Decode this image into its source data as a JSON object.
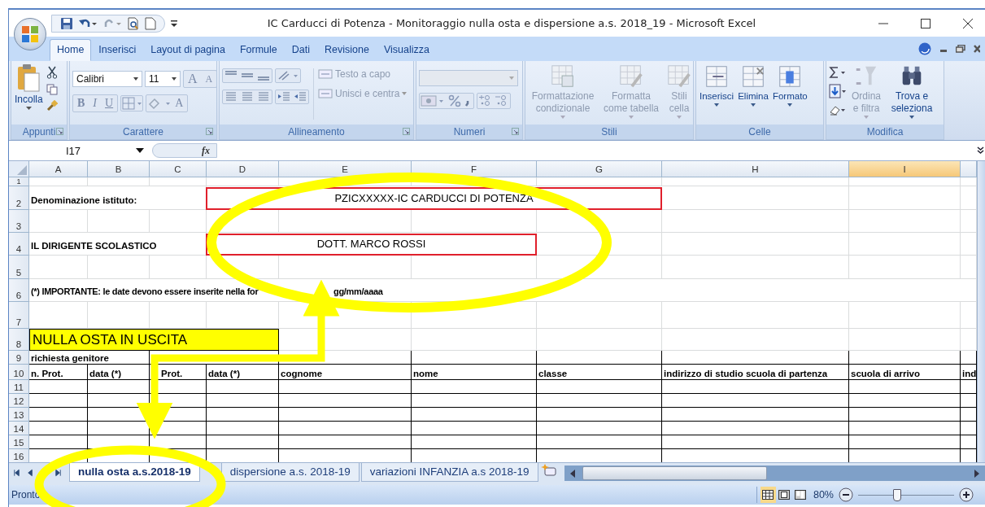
{
  "window": {
    "title": "IC Carducci di Potenza - Monitoraggio nulla osta e dispersione a.s. 2018_19 - Microsoft Excel"
  },
  "tabs": [
    {
      "label": "Home",
      "selected": true
    },
    {
      "label": "Inserisci",
      "selected": false
    },
    {
      "label": "Layout di pagina",
      "selected": false
    },
    {
      "label": "Formule",
      "selected": false
    },
    {
      "label": "Dati",
      "selected": false
    },
    {
      "label": "Revisione",
      "selected": false
    },
    {
      "label": "Visualizza",
      "selected": false
    }
  ],
  "ribbon": [
    {
      "kind": "clipboard",
      "label": "Appunti",
      "commands": [
        {
          "label": "Incolla",
          "disabled": false
        }
      ]
    },
    {
      "kind": "font",
      "label": "Carattere",
      "font": "Calibri",
      "size": "11",
      "buttons": [
        "B",
        "I",
        "U"
      ],
      "size_buttons": [
        "A",
        "A"
      ],
      "font_color": "A"
    },
    {
      "kind": "alignment",
      "label": "Allineamento",
      "commands": [
        {
          "label": "Testo a capo",
          "disabled": true
        },
        {
          "label": "Unisci e centra",
          "disabled": true
        }
      ]
    },
    {
      "kind": "number",
      "label": "Numeri"
    },
    {
      "kind": "styles",
      "label": "Stili",
      "commands": [
        {
          "label": "Formattazione condizionale",
          "disabled": true
        },
        {
          "label": "Formatta come tabella",
          "disabled": true
        },
        {
          "label": "Stili cella",
          "disabled": true
        }
      ]
    },
    {
      "kind": "cells",
      "label": "Celle",
      "commands": [
        {
          "label": "Inserisci",
          "disabled": false
        },
        {
          "label": "Elimina",
          "disabled": false
        },
        {
          "label": "Formato",
          "disabled": false
        }
      ]
    },
    {
      "kind": "editing",
      "label": "Modifica",
      "commands": [
        {
          "label": "Ordina e filtra",
          "disabled": true
        },
        {
          "label": "Trova e seleziona",
          "disabled": false
        }
      ]
    }
  ],
  "formula_bar": {
    "name_box": "I17",
    "function_symbol": "fx"
  },
  "columns": [
    {
      "label": "A",
      "selected": false
    },
    {
      "label": "B",
      "selected": false
    },
    {
      "label": "C",
      "selected": false
    },
    {
      "label": "D",
      "selected": false
    },
    {
      "label": "E",
      "selected": false
    },
    {
      "label": "F",
      "selected": false
    },
    {
      "label": "G",
      "selected": false
    },
    {
      "label": "H",
      "selected": false
    },
    {
      "label": "I",
      "selected": true
    }
  ],
  "rows": [
    {
      "number": "1",
      "kind": "plain"
    },
    {
      "number": "2",
      "kind": "plain",
      "cells": [
        {
          "kind": "label",
          "text": "Denominazione istituto:"
        },
        {
          "kind": "boxed",
          "text": "PZICXXXXX-IC CARDUCCI DI POTENZA"
        }
      ]
    },
    {
      "number": "3",
      "kind": "plain"
    },
    {
      "number": "4",
      "kind": "plain",
      "cells": [
        {
          "kind": "label",
          "text": "IL DIRIGENTE SCOLASTICO"
        },
        {
          "kind": "boxed",
          "text": "DOTT. MARCO ROSSI"
        }
      ]
    },
    {
      "number": "5",
      "kind": "plain"
    },
    {
      "number": "6",
      "kind": "plain",
      "cells": [
        {
          "kind": "note",
          "parts": [
            "(*) IMPORTANTE: le date devono essere inserite nella for",
            "gg/mm/aaaa"
          ]
        }
      ]
    },
    {
      "number": "7",
      "kind": "plain"
    },
    {
      "number": "8",
      "kind": "plain",
      "cells": [
        {
          "kind": "title",
          "text": "NULLA OSTA IN USCITA"
        }
      ]
    },
    {
      "number": "9",
      "kind": "table",
      "cells": [
        {
          "kind": "header",
          "text": "richiesta genitore"
        }
      ]
    },
    {
      "number": "10",
      "kind": "table",
      "cells": [
        {
          "kind": "header",
          "text": "n. Prot."
        },
        {
          "kind": "header",
          "text": "data (*)"
        },
        {
          "kind": "header",
          "text": "Prot."
        },
        {
          "kind": "header",
          "text": "data (*)"
        },
        {
          "kind": "header",
          "text": "cognome"
        },
        {
          "kind": "header",
          "text": "nome"
        },
        {
          "kind": "header",
          "text": "classe"
        },
        {
          "kind": "header",
          "text": "indirizzo di studio scuola di partenza"
        },
        {
          "kind": "header",
          "text": "scuola di arrivo"
        },
        {
          "kind": "header",
          "text": "ind"
        }
      ]
    },
    {
      "number": "11",
      "kind": "table"
    },
    {
      "number": "12",
      "kind": "table"
    },
    {
      "number": "13",
      "kind": "table"
    },
    {
      "number": "14",
      "kind": "table"
    },
    {
      "number": "15",
      "kind": "table"
    },
    {
      "number": "16",
      "kind": "table"
    }
  ],
  "sheets": [
    {
      "label": "nulla osta a.s.2018-19",
      "selected": true
    },
    {
      "label": "dispersione a.s. 2018-19",
      "selected": false
    },
    {
      "label": "variazioni INFANZIA a.s 2018-19",
      "selected": false
    }
  ],
  "status_bar": {
    "text": "Pronto",
    "views": [
      {
        "kind": "normal",
        "selected": true
      },
      {
        "kind": "layout",
        "selected": false
      },
      {
        "kind": "break",
        "selected": false
      }
    ],
    "zoom": "80%",
    "zoom_slider": {
      "level": 0.4
    }
  }
}
